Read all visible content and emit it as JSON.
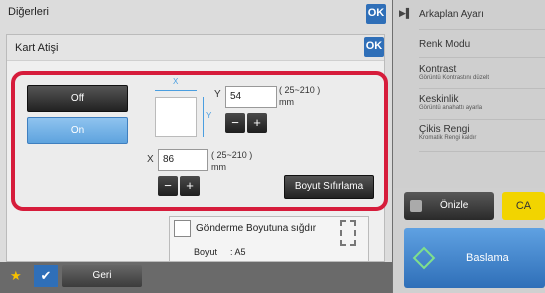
{
  "main": {
    "title": "Diğerleri",
    "ok_label": "OK"
  },
  "dialog": {
    "title": "Kart Atişi",
    "ok_label": "OK",
    "off_label": "Off",
    "on_label": "On",
    "y_axis_letter": "Y",
    "y_value": "54",
    "y_range": "( 25~210 )",
    "y_unit": "mm",
    "x_axis_letter": "X",
    "x_value": "86",
    "x_range": "( 25~210 )",
    "x_unit": "mm",
    "minus_label": "−",
    "plus_label": "+",
    "diagram_x": "X",
    "diagram_y": "Y",
    "reset_label": "Boyut Sıfırlama",
    "fit_label": "Gönderme Boyutuna sığdır",
    "size_label": "Boyut",
    "size_value": ": A5"
  },
  "right_menu": [
    {
      "title": "Arkaplan Ayarı",
      "sub": ""
    },
    {
      "title": "Renk Modu",
      "sub": ""
    },
    {
      "title": "Kontrast",
      "sub": "Görüntü Kontrastını düzelt"
    },
    {
      "title": "Keskinlik",
      "sub": "Görüntü anahattı ayarla"
    },
    {
      "title": "Çikis Rengi",
      "sub": "Kromatik Rengi kaldır"
    }
  ],
  "bottom": {
    "back_label": "Geri",
    "preview_label": "Önizle",
    "ca_label": "CA",
    "start_label": "Baslama"
  },
  "colors": {
    "accent_red": "#d61c3b",
    "accent_blue": "#2f6fb8",
    "ca_yellow": "#f2d400"
  }
}
